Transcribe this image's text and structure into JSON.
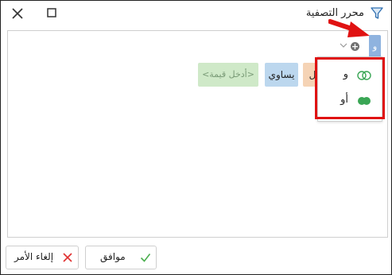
{
  "window": {
    "title": "محرر التصفية",
    "close_icon": "close-icon",
    "maximize_icon": "maximize-icon",
    "filter_icon": "filter-icon"
  },
  "group": {
    "operator_label": "و",
    "add_icon": "add-circle-icon",
    "add_glyph": "+",
    "dropdown_icon": "chevron-down-icon"
  },
  "condition": {
    "field_partial": "يل",
    "operator": "يساوي",
    "value_placeholder": "<أدخل قيمة>"
  },
  "dropdown": {
    "items": [
      {
        "label": "و",
        "icon": "and-toggle-icon"
      },
      {
        "label": "أو",
        "icon": "or-toggle-icon"
      }
    ]
  },
  "buttons": {
    "ok_label": "موافق",
    "cancel_label": "إلغاء الأمر"
  },
  "colors": {
    "group_node": "#8fb3df",
    "value_chip": "#cfe9c8",
    "operator_chip": "#bcd7ee",
    "field_chip": "#f5d3b5",
    "highlight": "#e01212",
    "ok_check": "#4caf50",
    "cancel_x": "#e03030"
  }
}
